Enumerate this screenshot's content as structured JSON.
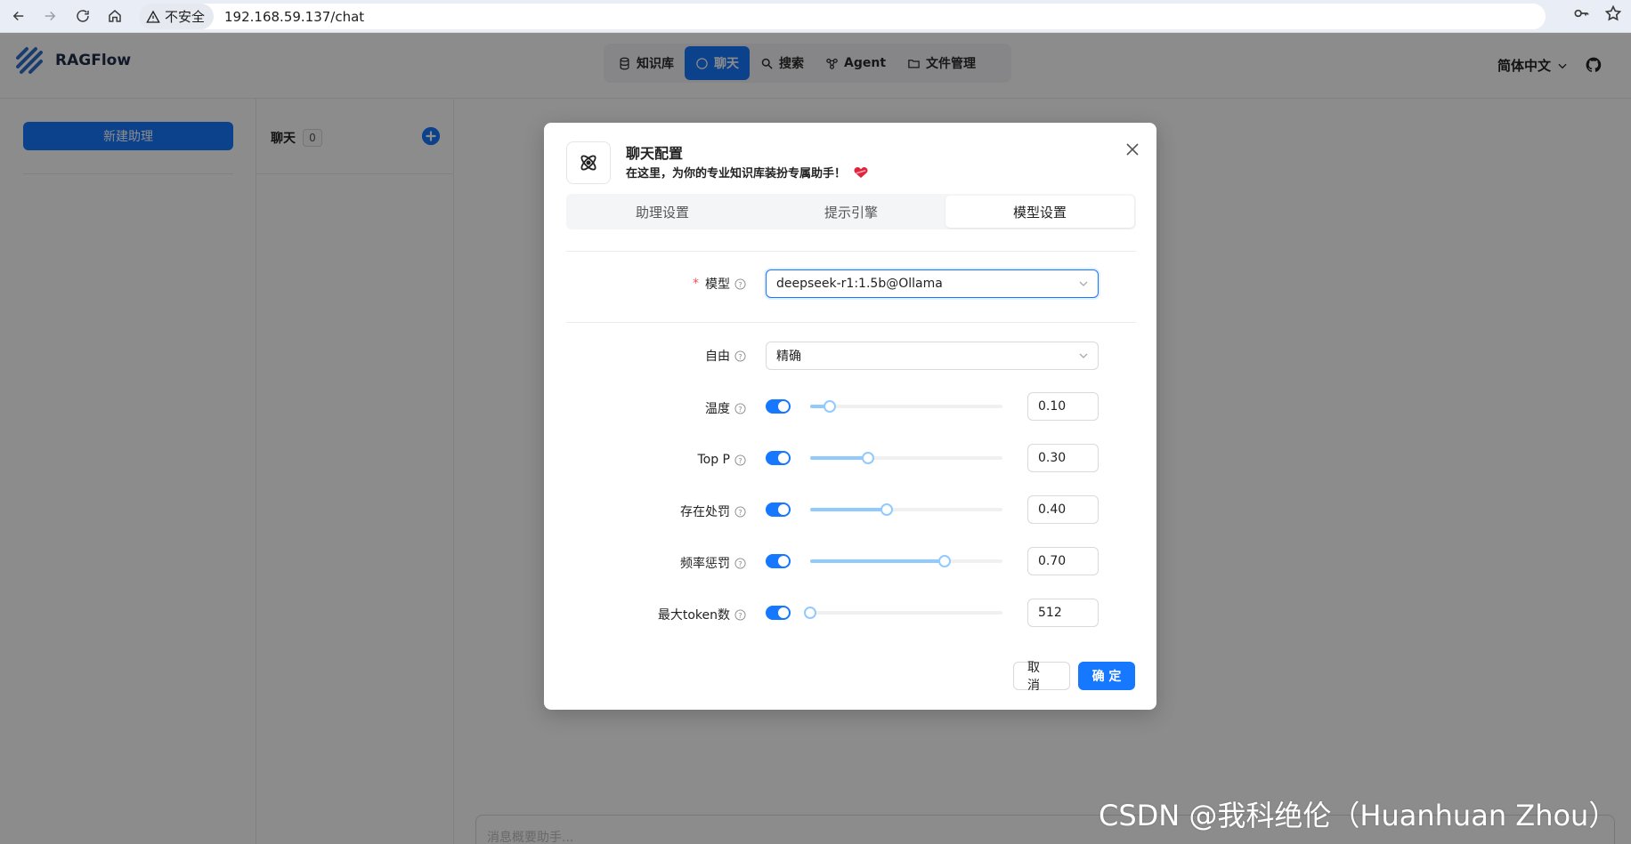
{
  "browser": {
    "security_label": "不安全",
    "url": "192.168.59.137/chat"
  },
  "app": {
    "logo_text": "RAGFlow",
    "nav": [
      {
        "label": "知识库",
        "icon": "database-icon",
        "active": false
      },
      {
        "label": "聊天",
        "icon": "chat-icon",
        "active": true
      },
      {
        "label": "搜索",
        "icon": "search-icon",
        "active": false
      },
      {
        "label": "Agent",
        "icon": "agent-icon",
        "active": false
      },
      {
        "label": "文件管理",
        "icon": "folder-icon",
        "active": false
      }
    ],
    "language": "简体中文"
  },
  "sidebar": {
    "new_assistant_label": "新建助理"
  },
  "chat_list": {
    "title": "聊天",
    "count": "0"
  },
  "composer": {
    "placeholder": "消息概要助手..."
  },
  "modal": {
    "title": "聊天配置",
    "subtitle": "在这里，为你的专业知识库装扮专属助手！",
    "tabs": [
      {
        "label": "助理设置",
        "active": false
      },
      {
        "label": "提示引擎",
        "active": false
      },
      {
        "label": "模型设置",
        "active": true
      }
    ],
    "model": {
      "label": "模型",
      "value": "deepseek-r1:1.5b@Ollama"
    },
    "freedom": {
      "label": "自由",
      "value": "精确"
    },
    "params": [
      {
        "label": "温度",
        "value": "0.10",
        "fraction": 0.1
      },
      {
        "label": "Top P",
        "value": "0.30",
        "fraction": 0.3
      },
      {
        "label": "存在处罚",
        "value": "0.40",
        "fraction": 0.4
      },
      {
        "label": "频率惩罚",
        "value": "0.70",
        "fraction": 0.7
      },
      {
        "label": "最大token数",
        "value": "512",
        "fraction": 0.0
      }
    ],
    "cancel_label": "取 消",
    "ok_label": "确 定"
  },
  "watermark": "CSDN @我科绝伦（Huanhuan Zhou）",
  "colors": {
    "primary": "#1677ff",
    "slider_track": "#91caff",
    "required": "#ff4d4f"
  }
}
